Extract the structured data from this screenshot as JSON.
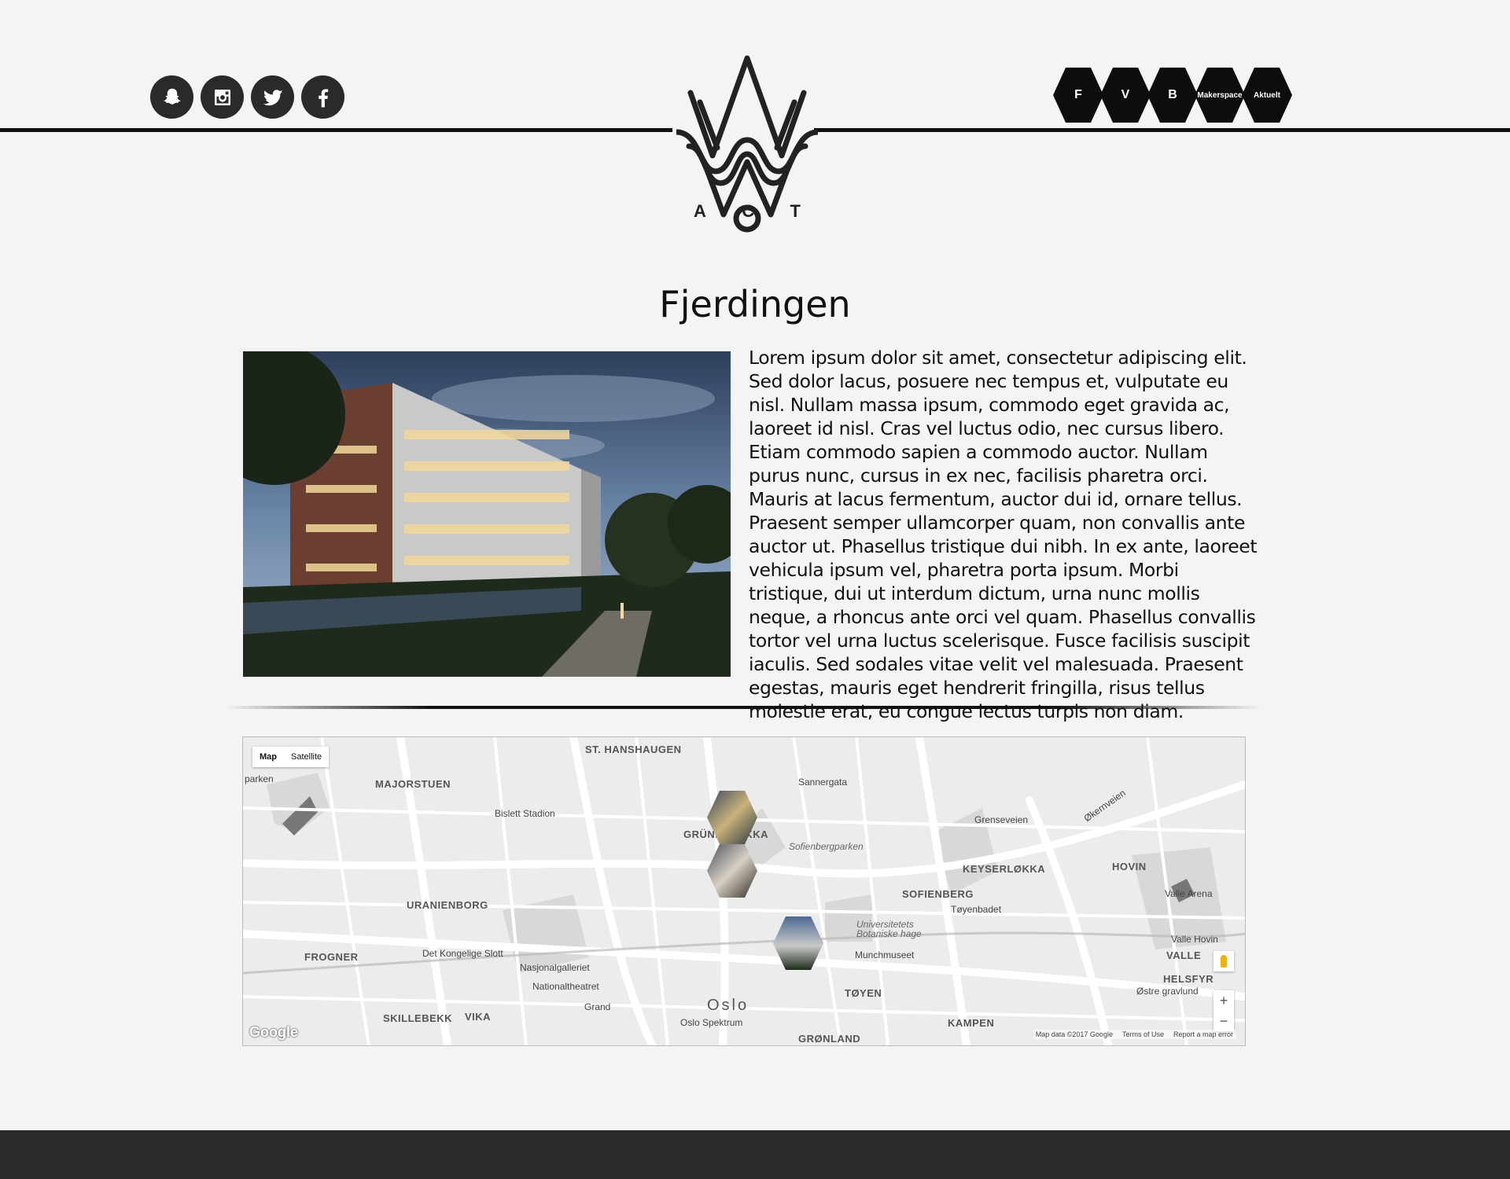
{
  "header": {
    "social": [
      {
        "icon": "snapchat-icon"
      },
      {
        "icon": "instagram-icon"
      },
      {
        "icon": "twitter-icon"
      },
      {
        "icon": "facebook-icon"
      }
    ],
    "logo_letters": [
      "A",
      "C",
      "T"
    ],
    "nav": [
      "F",
      "V",
      "B",
      "Makerspace",
      "Aktuelt"
    ]
  },
  "main": {
    "title": "Fjerdingen",
    "body": "Lorem ipsum dolor sit amet, consectetur adipiscing elit. Sed dolor lacus, posuere nec tempus et, vulputate eu nisl. Nullam massa ipsum, commodo eget gravida ac, laoreet id nisl. Cras vel luctus odio, nec cursus libero. Etiam commodo sapien a commodo auctor. Nullam purus nunc, cursus in ex nec, facilisis pharetra orci. Mauris at lacus fermentum, auctor dui id, ornare tellus. Praesent semper ullamcorper quam, non convallis ante auctor ut. Phasellus tristique dui nibh. In ex ante, laoreet vehicula ipsum vel, pharetra porta ipsum. Morbi tristique, dui ut interdum dictum, urna nunc mollis neque, a rhoncus ante orci vel quam. Phasellus convallis tortor vel urna luctus scelerisque. Fusce facilisis suscipit iaculis. Sed sodales vitae velit vel malesuada. Praesent egestas, mauris eget hendrerit fringilla, risus tellus molestie erat, eu congue lectus turpis non diam."
  },
  "map": {
    "type_map": "Map",
    "type_satellite": "Satellite",
    "labels": {
      "st_hanshaugen": "ST. HANSHAUGEN",
      "majorstuen": "MAJORSTUEN",
      "grunerlokka": "GRÜNERLØKKA",
      "sofienbergparken": "Sofienbergparken",
      "bislett": "Bislett Stadion",
      "keyserlokka": "KEYSERLØKKA",
      "sofienberg": "SOFIENBERG",
      "hovin": "HOVIN",
      "uranienborg": "URANIENBORG",
      "frogner": "FROGNER",
      "slott": "Det Kongelige Slott",
      "nasjonalgalleriet": "Nasjonalgalleriet",
      "nationaltheatret": "Nationaltheatret",
      "toyenbadet": "Tøyenbadet",
      "botanisk": "Universitetets Botaniske hage",
      "munchmuseet": "Munchmuseet",
      "valle_hovin": "Valle Hovin",
      "valle": "VALLE",
      "helsfyr": "HELSFYR",
      "ostre": "Østre gravlund",
      "toyen": "TØYEN",
      "oslo": "Oslo",
      "oslo_spektrum": "Oslo Spektrum",
      "skillebekk": "SKILLEBEKK",
      "vika": "VIKA",
      "kampen": "KAMPEN",
      "gronland": "GRØNLAND",
      "grensen": "Grenseveien",
      "okern": "Økernveien",
      "valle_arena": "Valle Arena",
      "parken": "parken",
      "sannergata": "Sannergata",
      "grand": "Grand"
    },
    "google": "Google",
    "data": "Map data ©2017 Google",
    "terms": "Terms of Use",
    "report": "Report a map error",
    "zoom_in": "+",
    "zoom_out": "−"
  }
}
